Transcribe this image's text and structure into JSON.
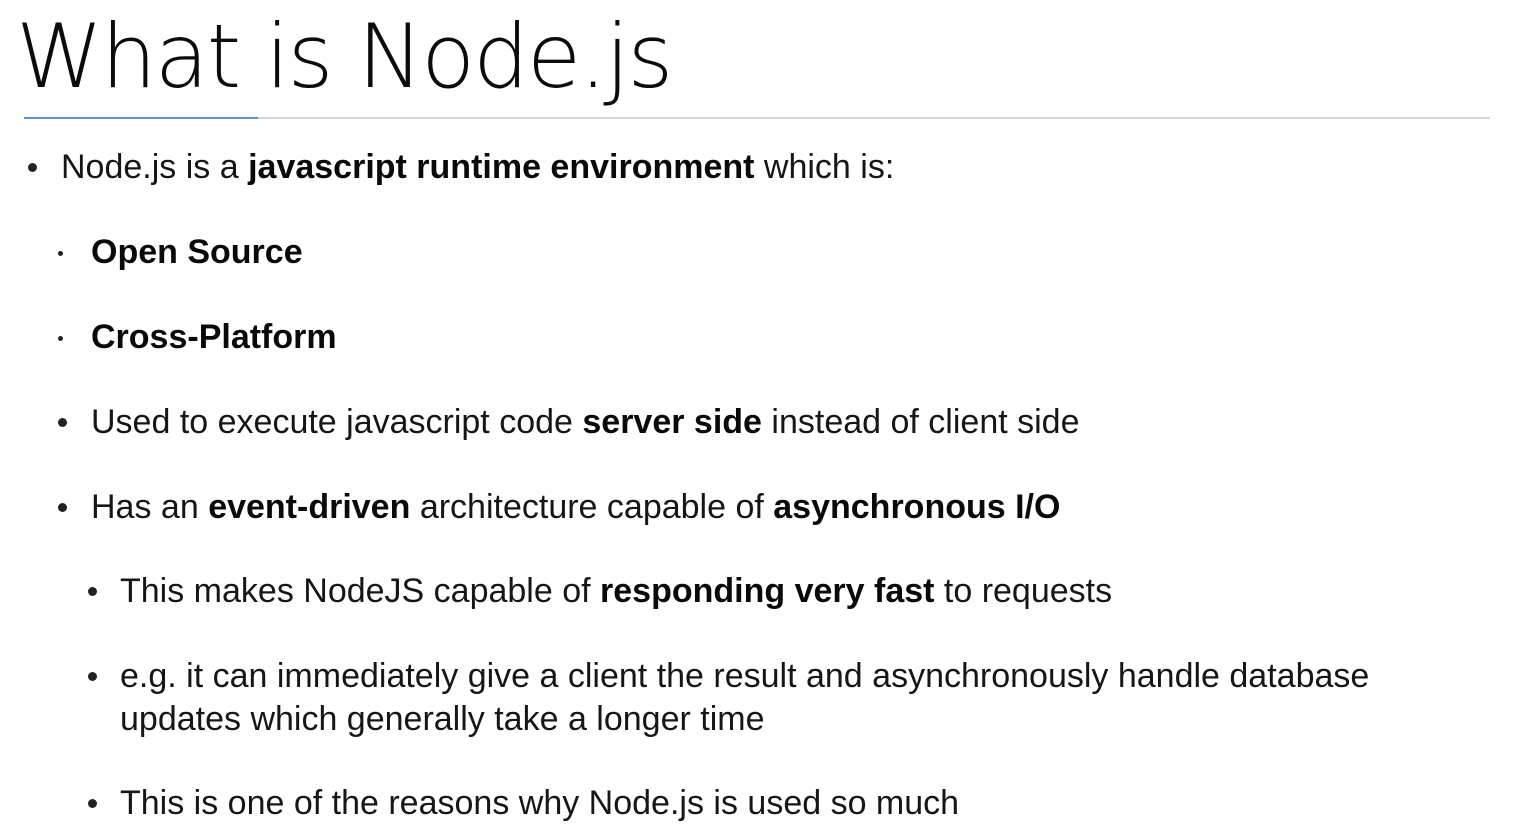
{
  "title": "What is Node.js",
  "bullets": {
    "b1": {
      "pre": "Node.js is a ",
      "bold": "javascript runtime environment",
      "post": " which is:"
    },
    "b2": {
      "bold": "Open Source"
    },
    "b3": {
      "bold": "Cross-Platform"
    },
    "b4": {
      "pre": "Used to execute javascript code ",
      "bold": "server side",
      "post": " instead of client side"
    },
    "b5": {
      "pre": "Has an ",
      "bold1": "event-driven",
      "mid": " architecture capable of ",
      "bold2": "asynchronous I/O"
    },
    "b6": {
      "pre": "This makes NodeJS capable of ",
      "bold": "responding very fast",
      "post": " to requests"
    },
    "b7": {
      "line1": "e.g. it can immediately give a client the result and asynchronously handle database",
      "line2": "updates which generally take a longer time"
    },
    "b8": {
      "text": "This is one of the reasons why Node.js is used so much"
    }
  }
}
